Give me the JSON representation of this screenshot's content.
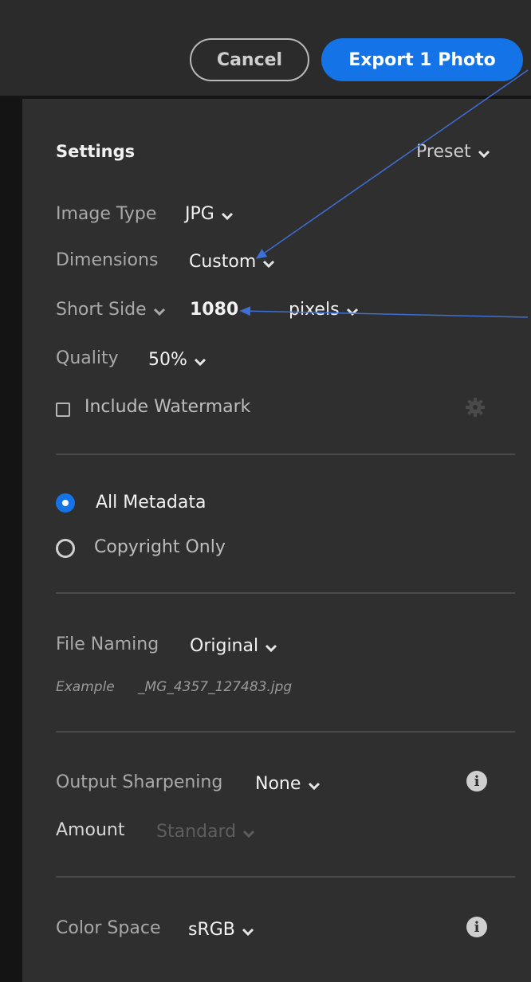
{
  "header": {
    "cancel_label": "Cancel",
    "export_label": "Export 1 Photo"
  },
  "settings": {
    "title": "Settings",
    "preset_label": "Preset",
    "image_type": {
      "label": "Image Type",
      "value": "JPG"
    },
    "dimensions": {
      "label": "Dimensions",
      "value": "Custom"
    },
    "short_side": {
      "label": "Short Side",
      "value": "1080",
      "unit": "pixels"
    },
    "quality": {
      "label": "Quality",
      "value": "50%"
    },
    "watermark": {
      "label": "Include Watermark",
      "checked": false
    }
  },
  "metadata": {
    "all_label": "All Metadata",
    "copyright_label": "Copyright Only",
    "selected": "All Metadata"
  },
  "file_naming": {
    "label": "File Naming",
    "value": "Original",
    "example_label": "Example",
    "example_value": "_MG_4357_127483.jpg"
  },
  "sharpening": {
    "label": "Output Sharpening",
    "value": "None",
    "amount_label": "Amount",
    "amount_value": "Standard"
  },
  "color_space": {
    "label": "Color Space",
    "value": "sRGB"
  },
  "colors": {
    "accent": "#1473e6",
    "panel": "#2f2f2f",
    "annotation": "#3d6fd6"
  }
}
